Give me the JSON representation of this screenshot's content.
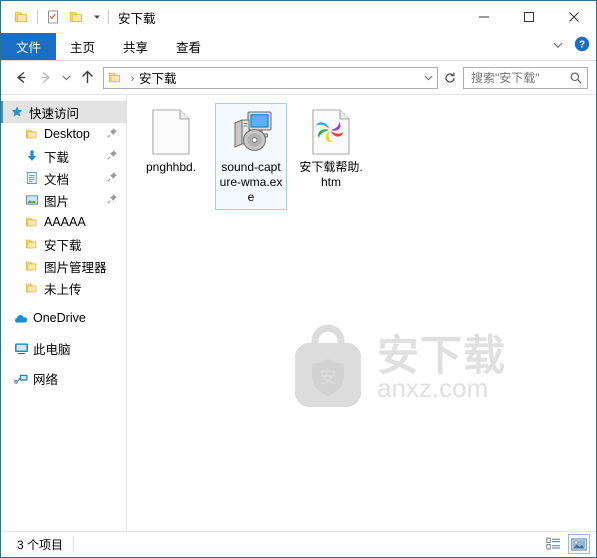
{
  "window": {
    "title": "安下载",
    "quick_access": [
      {
        "name": "folder-icon",
        "label": ""
      },
      {
        "name": "properties-icon",
        "label": ""
      },
      {
        "name": "new-folder-icon",
        "label": ""
      }
    ],
    "controls": {
      "minimize": "–",
      "maximize": "□",
      "close": "✕"
    }
  },
  "ribbon": {
    "tabs": [
      {
        "label": "文件",
        "active": true
      },
      {
        "label": "主页",
        "active": false
      },
      {
        "label": "共享",
        "active": false
      },
      {
        "label": "查看",
        "active": false
      }
    ],
    "expand_icon": "chevron-down-icon",
    "help_icon": "help-icon"
  },
  "navbar": {
    "back": "←",
    "forward": "→",
    "recent": "∨",
    "up": "↑",
    "breadcrumb": {
      "folder_icon": "folder-icon",
      "separator": "›",
      "path": "安下载"
    },
    "refresh": "↻"
  },
  "search": {
    "placeholder": "搜索\"安下载\"",
    "value": ""
  },
  "sidebar": {
    "items": [
      {
        "label": "快速访问",
        "icon": "star-icon",
        "level": 0,
        "selected": true,
        "pinned": false
      },
      {
        "label": "Desktop",
        "icon": "folder-icon",
        "level": 1,
        "selected": false,
        "pinned": true
      },
      {
        "label": "下载",
        "icon": "download-icon",
        "level": 1,
        "selected": false,
        "pinned": true
      },
      {
        "label": "文档",
        "icon": "documents-icon",
        "level": 1,
        "selected": false,
        "pinned": true
      },
      {
        "label": "图片",
        "icon": "pictures-icon",
        "level": 1,
        "selected": false,
        "pinned": true
      },
      {
        "label": "AAAAA",
        "icon": "folder-icon",
        "level": 1,
        "selected": false,
        "pinned": false
      },
      {
        "label": "安下载",
        "icon": "folder-icon",
        "level": 1,
        "selected": false,
        "pinned": false
      },
      {
        "label": "图片管理器",
        "icon": "folder-icon",
        "level": 1,
        "selected": false,
        "pinned": false
      },
      {
        "label": "未上传",
        "icon": "folder-icon",
        "level": 1,
        "selected": false,
        "pinned": false
      }
    ],
    "roots": [
      {
        "label": "OneDrive",
        "icon": "onedrive-icon"
      },
      {
        "label": "此电脑",
        "icon": "this-pc-icon"
      },
      {
        "label": "网络",
        "icon": "network-icon"
      }
    ]
  },
  "files": [
    {
      "name": "pnghhbd.",
      "icon": "blank-file-icon",
      "selected": false
    },
    {
      "name": "sound-capture-wma.exe",
      "icon": "exe-icon",
      "selected": true
    },
    {
      "name": "安下载帮助.htm",
      "icon": "htm-icon",
      "selected": false
    }
  ],
  "watermark": {
    "brand": "安下载",
    "url": "anxz.com",
    "shield_char": "安"
  },
  "statusbar": {
    "item_count": "3 个项目",
    "views": [
      {
        "name": "details-view",
        "active": false
      },
      {
        "name": "large-icons-view",
        "active": true
      }
    ]
  },
  "colors": {
    "accent": "#1a6fc4",
    "window_border": "#2f6f8f",
    "selection_border": "#a8cfe8",
    "selection_fill": "#f4fafd",
    "sidebar_selected": "#e3e3e3",
    "watermark": "#e0e0e0"
  }
}
